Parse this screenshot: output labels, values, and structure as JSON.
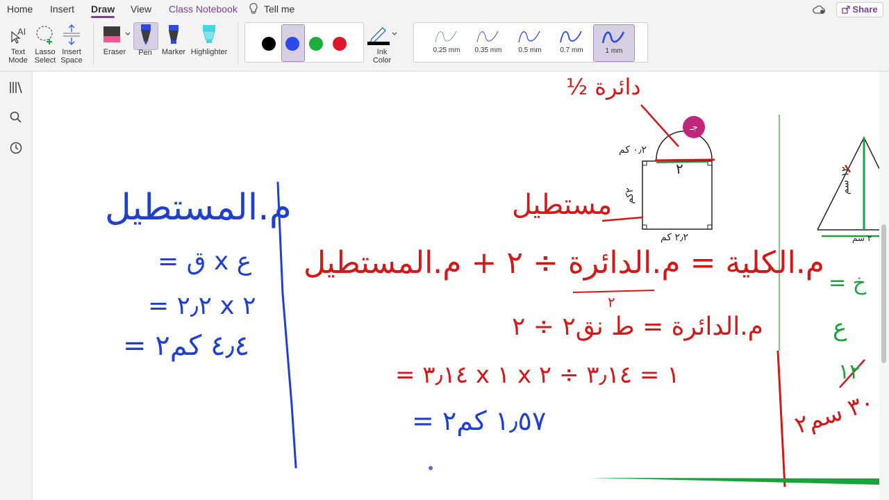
{
  "tabs": [
    {
      "label": "Home"
    },
    {
      "label": "Insert"
    },
    {
      "label": "Draw",
      "active": true
    },
    {
      "label": "View"
    },
    {
      "label": "Class Notebook"
    },
    {
      "label": "Tell me"
    }
  ],
  "share_label": "Share",
  "tools": {
    "text_mode": "Text\nMode",
    "text_mode_l1": "Text",
    "text_mode_l2": "Mode",
    "lasso_l1": "Lasso",
    "lasso_l2": "Select",
    "insert_l1": "Insert",
    "insert_l2": "Space",
    "eraser": "Eraser",
    "pen": "Pen",
    "marker": "Marker",
    "highlighter": "Highlighter",
    "ink_color_l1": "Ink",
    "ink_color_l2": "Color"
  },
  "palette": [
    {
      "name": "black",
      "color": "#000000"
    },
    {
      "name": "blue",
      "color": "#2b4be8",
      "selected": true
    },
    {
      "name": "green",
      "color": "#1cae3b"
    },
    {
      "name": "red",
      "color": "#e0162b"
    }
  ],
  "thickness": [
    {
      "label": "0.25 mm"
    },
    {
      "label": "0.35 mm"
    },
    {
      "label": "0.5 mm"
    },
    {
      "label": "0.7 mm"
    },
    {
      "label": "1 mm",
      "selected": true
    }
  ],
  "badge": "جـ",
  "ink": {
    "left_title": "م.المستطيل",
    "left_l1": "= ق x ع",
    "left_l2": "= ٢٫٢ x ٢",
    "left_l3": "= ٤٫٤ كم٢",
    "half_circle": "½ دائرة",
    "rect_word": "مستطيل",
    "dim_top": "٠٫٢ كم",
    "dim_side": "٢كم",
    "dim_bottom": "٢٫٢ كم",
    "mid_two": "٢",
    "main_eq": "م.الكلية = م.الدائرة ÷ ٢ + م.المستطيل",
    "main_half_den": "٢",
    "circle_area": "م.الدائرة = ط نق٢ ÷ ٢",
    "calc": "= ٣٫١٤ x ١ x ١ = ٣٫١٤ ÷ ٢",
    "result": "= ١٫٥٧ كم٢",
    "tri_height": "١٢ سم",
    "tri_base": "٢ سم",
    "right_a": "ع",
    "right_b": "١٢",
    "right_c": "٣٠ سم٢",
    "right_eq": "= خ"
  }
}
